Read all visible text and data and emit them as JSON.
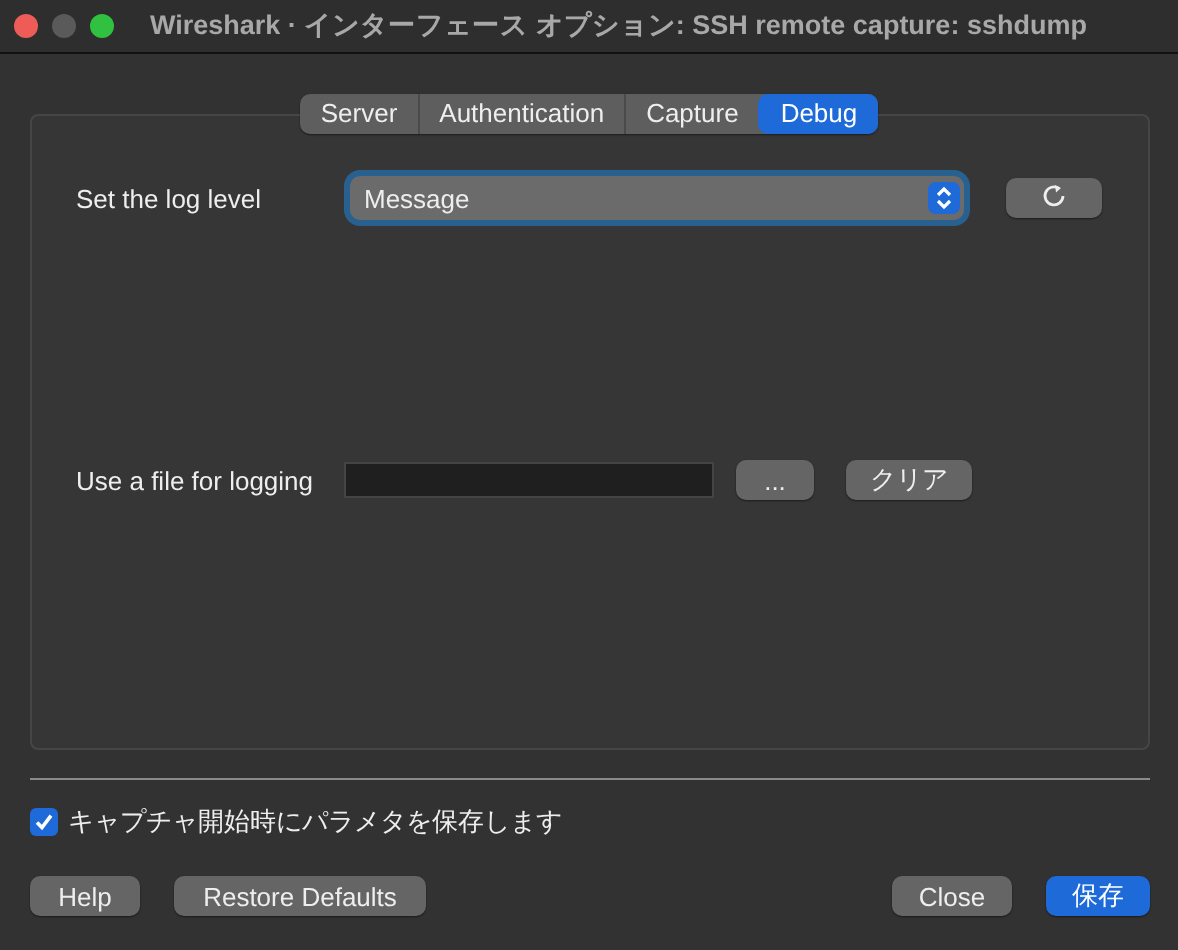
{
  "window": {
    "title": "Wireshark · インターフェース オプション: SSH remote capture: sshdump"
  },
  "tabs": [
    {
      "label": "Server",
      "selected": false
    },
    {
      "label": "Authentication",
      "selected": false
    },
    {
      "label": "Capture",
      "selected": false
    },
    {
      "label": "Debug",
      "selected": true
    }
  ],
  "log_level": {
    "label": "Set the log level",
    "value": "Message"
  },
  "log_file": {
    "label": "Use a file for logging",
    "browse_button": "...",
    "clear_button": "クリア"
  },
  "save_parameters": {
    "label": "キャプチャ開始時にパラメタを保存します",
    "checked": true
  },
  "buttons": [
    {
      "label": "Help",
      "kind": "normal"
    },
    {
      "label": "Restore Defaults",
      "kind": "normal"
    },
    {
      "label": "Close",
      "kind": "normal"
    },
    {
      "label": "保存",
      "kind": "primary"
    }
  ]
}
